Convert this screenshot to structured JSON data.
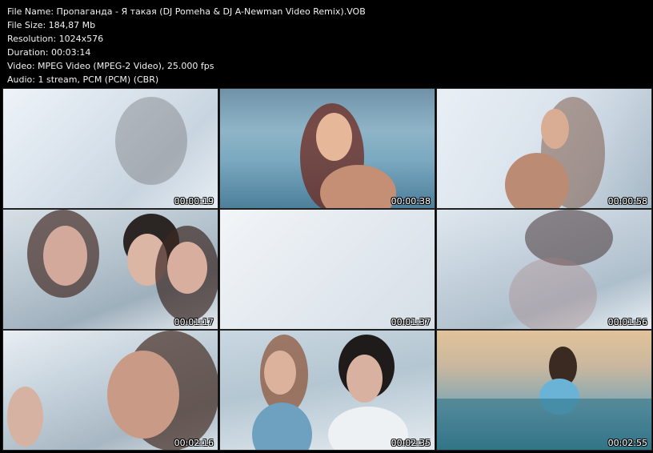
{
  "info": [
    "File Name: Пропаганда - Я такая (DJ Pomeha & DJ A-Newman Video Remix).VOB",
    "File Size: 184,87 Mb",
    "Resolution: 1024x576",
    "Duration: 00:03:14",
    "Video: MPEG Video (MPEG-2 Video), 25.000 fps",
    "Audio: 1 stream, PCM (PCM) (CBR)"
  ],
  "thumbnails": [
    {
      "time": "00:00:19"
    },
    {
      "time": "00:00:38"
    },
    {
      "time": "00:00:58"
    },
    {
      "time": "00:01:17"
    },
    {
      "time": "00:01:37"
    },
    {
      "time": "00:01:56"
    },
    {
      "time": "00:02:16"
    },
    {
      "time": "00:02:35"
    },
    {
      "time": "00:02:55"
    }
  ]
}
